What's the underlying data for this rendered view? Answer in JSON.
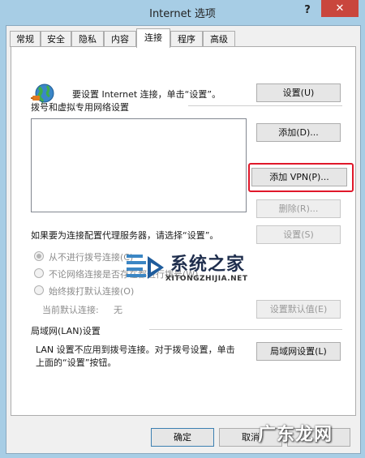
{
  "window": {
    "title": "Internet 选项",
    "help_glyph": "?",
    "close_glyph": "✕"
  },
  "tabs": [
    "常规",
    "安全",
    "隐私",
    "内容",
    "连接",
    "程序",
    "高级"
  ],
  "active_tab": "连接",
  "setup": {
    "text": "要设置 Internet 连接，单击“设置”。",
    "button": "设置(U)"
  },
  "dialup": {
    "section_title": "拨号和虚拟专用网络设置",
    "add_button": "添加(D)...",
    "add_vpn_button": "添加 VPN(P)...",
    "remove_button": "删除(R)...",
    "proxy_text": "如果要为连接配置代理服务器，请选择“设置”。",
    "settings_button": "设置(S)",
    "options": [
      {
        "label": "从不进行拨号连接(C)",
        "checked": true
      },
      {
        "label": "不论网络连接是否存在都进行拨号(W)",
        "checked": false
      },
      {
        "label": "始终拨打默认连接(O)",
        "checked": false
      }
    ],
    "current_default_label": "当前默认连接:",
    "current_default_value": "无",
    "set_default_button": "设置默认值(E)"
  },
  "lan": {
    "section_title": "局域网(LAN)设置",
    "text_line1": "LAN 设置不应用到拨号连接。对于拨号设置，单击",
    "text_line2": "上面的“设置”按钮。",
    "button": "局域网设置(L)"
  },
  "footer": {
    "ok": "确定",
    "cancel": "取消"
  },
  "watermarks": {
    "site_name": "系统之家",
    "site_domain": "XITONGZHIJIA.NET",
    "corner": "广东龙网"
  },
  "colors": {
    "highlight_box": "#e0182a",
    "close_button": "#c9463d"
  }
}
